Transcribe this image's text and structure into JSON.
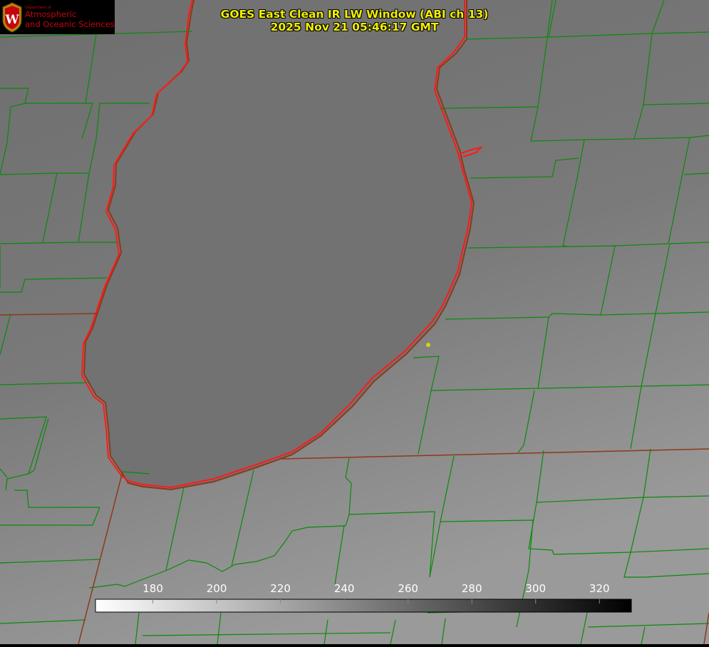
{
  "logo": {
    "department": "Department of",
    "line1": "Atmospheric",
    "line2": "and Oceanic Sciences"
  },
  "title": "GOES East Clean IR LW Window (ABI ch 13)",
  "timestamp": "2025 Nov 21 05:46:17 GMT",
  "colorbar": {
    "ticks": [
      "180",
      "200",
      "220",
      "240",
      "260",
      "280",
      "300",
      "320"
    ],
    "tick_values": [
      180,
      200,
      220,
      240,
      260,
      280,
      300,
      320
    ],
    "range": [
      162,
      330
    ],
    "gradient": "white-to-black",
    "label_color": "#ffffff"
  },
  "colors": {
    "boundary_green": "#0a8a0a",
    "coastline_red": "#ff1a1a",
    "state_line_brown": "#8b3a1a",
    "title_yellow": "#f2ef00",
    "marker_yellow": "#d6d60a",
    "logo_red": "#c5050c"
  }
}
